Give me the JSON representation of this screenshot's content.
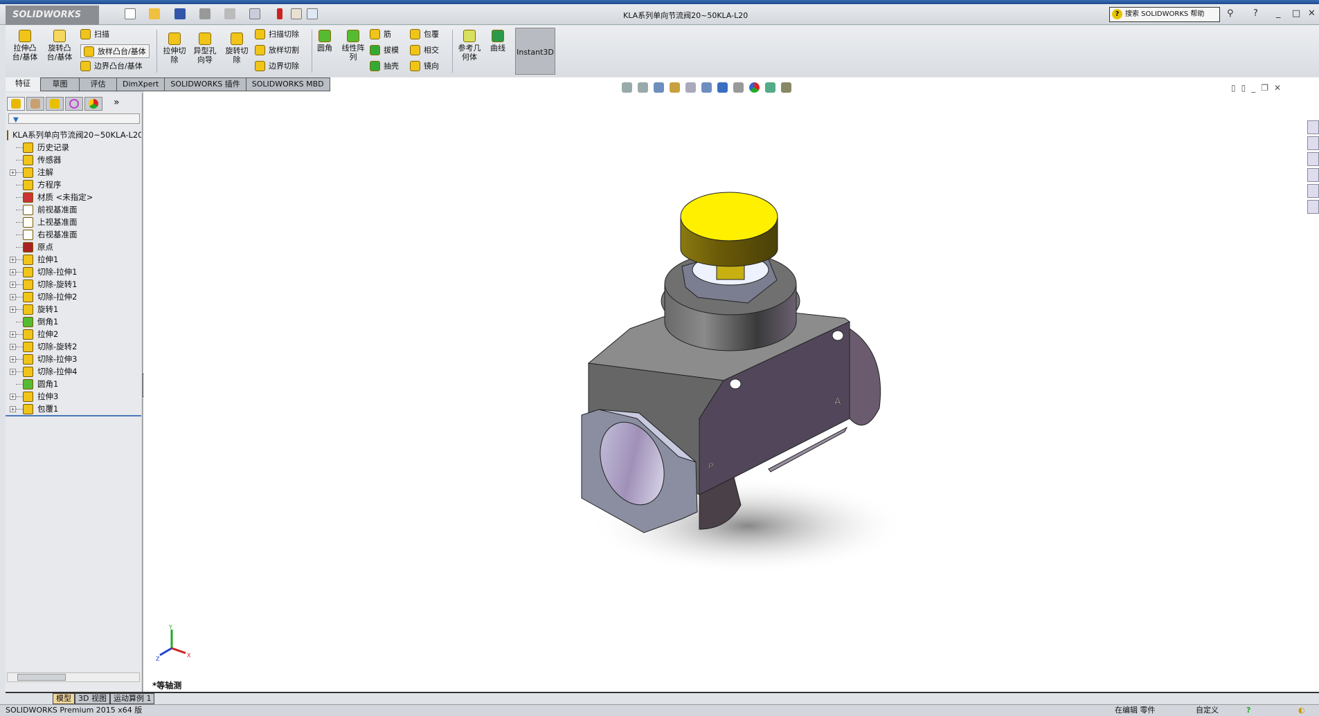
{
  "app": {
    "logo": "SOLIDWORKS",
    "doc_title": "KLA系列单向节流阀20~50KLA-L20",
    "search_placeholder": "搜索 SOLIDWORKS 帮助"
  },
  "ribbon": {
    "large": [
      {
        "label": "拉伸凸\n台/基体"
      },
      {
        "label": "旋转凸\n台/基体"
      },
      {
        "label": "拉伸切\n除"
      },
      {
        "label": "异型孔\n向导"
      },
      {
        "label": "旋转切\n除"
      },
      {
        "label": "圆角"
      },
      {
        "label": "线性阵\n列"
      },
      {
        "label": "参考几\n何体"
      },
      {
        "label": "曲线"
      }
    ],
    "small": [
      {
        "label": "扫描"
      },
      {
        "label": "放样凸台/基体"
      },
      {
        "label": "边界凸台/基体"
      },
      {
        "label": "扫描切除"
      },
      {
        "label": "放样切割"
      },
      {
        "label": "边界切除"
      },
      {
        "label": "筋"
      },
      {
        "label": "拔模"
      },
      {
        "label": "抽壳"
      },
      {
        "label": "包覆"
      },
      {
        "label": "相交"
      },
      {
        "label": "镜向"
      }
    ],
    "instant3d": "Instant3D"
  },
  "tabs": [
    "特征",
    "草图",
    "评估",
    "DimXpert",
    "SOLIDWORKS 插件",
    "SOLIDWORKS MBD"
  ],
  "tree": {
    "root": "KLA系列单向节流阀20~50KLA-L20",
    "items": [
      {
        "label": "历史记录",
        "expand": false,
        "color": "#f0c419"
      },
      {
        "label": "传感器",
        "expand": false,
        "color": "#f0c419"
      },
      {
        "label": "注解",
        "expand": true,
        "color": "#f0c419"
      },
      {
        "label": "方程序",
        "expand": false,
        "color": "#f0c419"
      },
      {
        "label": "材质 <未指定>",
        "expand": false,
        "color": "#cc3333"
      },
      {
        "label": "前视基准面",
        "expand": false,
        "color": "#ffffff"
      },
      {
        "label": "上视基准面",
        "expand": false,
        "color": "#ffffff"
      },
      {
        "label": "右视基准面",
        "expand": false,
        "color": "#ffffff"
      },
      {
        "label": "原点",
        "expand": false,
        "color": "#aa2222"
      },
      {
        "label": "拉伸1",
        "expand": true,
        "color": "#f0c419"
      },
      {
        "label": "切除-拉伸1",
        "expand": true,
        "color": "#f0c419"
      },
      {
        "label": "切除-旋转1",
        "expand": true,
        "color": "#f0c419"
      },
      {
        "label": "切除-拉伸2",
        "expand": true,
        "color": "#f0c419"
      },
      {
        "label": "旋转1",
        "expand": true,
        "color": "#f0c419"
      },
      {
        "label": "倒角1",
        "expand": false,
        "color": "#55bb33"
      },
      {
        "label": "拉伸2",
        "expand": true,
        "color": "#f0c419"
      },
      {
        "label": "切除-旋转2",
        "expand": true,
        "color": "#f0c419"
      },
      {
        "label": "切除-拉伸3",
        "expand": true,
        "color": "#f0c419"
      },
      {
        "label": "切除-拉伸4",
        "expand": true,
        "color": "#f0c419"
      },
      {
        "label": "圆角1",
        "expand": false,
        "color": "#55bb33"
      },
      {
        "label": "拉伸3",
        "expand": true,
        "color": "#f0c419"
      },
      {
        "label": "包覆1",
        "expand": true,
        "color": "#f0c419"
      }
    ]
  },
  "viewport": {
    "view_name": "*等轴测",
    "model_labels": {
      "port_a": "A",
      "port_p": "P"
    },
    "axes": {
      "x": "X",
      "y": "Y",
      "z": "Z"
    }
  },
  "bottom_tabs": [
    "模型",
    "3D 视图",
    "运动算例 1"
  ],
  "status": {
    "product": "SOLIDWORKS Premium 2015 x64 版",
    "mode": "在编辑 零件",
    "units": "自定义"
  }
}
